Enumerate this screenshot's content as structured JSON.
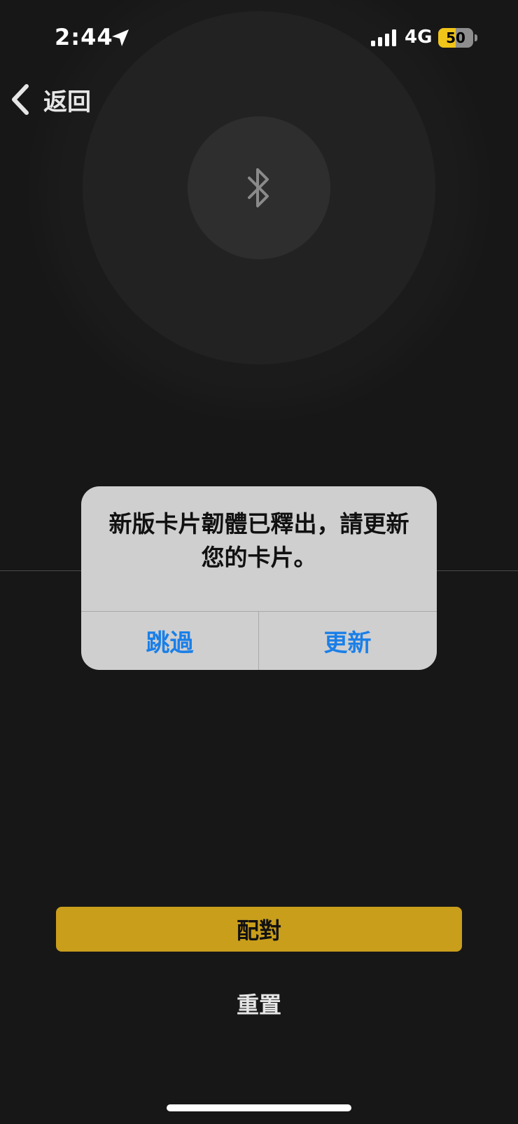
{
  "status_bar": {
    "time": "2:44",
    "network": "4G",
    "battery_level": "50",
    "battery_fraction": 0.5
  },
  "nav": {
    "back_label": "返回"
  },
  "alert": {
    "message": "新版卡片韌體已釋出，請更新您的卡片。",
    "skip_label": "跳過",
    "update_label": "更新"
  },
  "actions": {
    "pair_label": "配對",
    "reset_label": "重置"
  },
  "colors": {
    "background": "#171717",
    "accent": "#c99e1b",
    "alert_button": "#1a7fe8",
    "battery": "#f0c419"
  }
}
